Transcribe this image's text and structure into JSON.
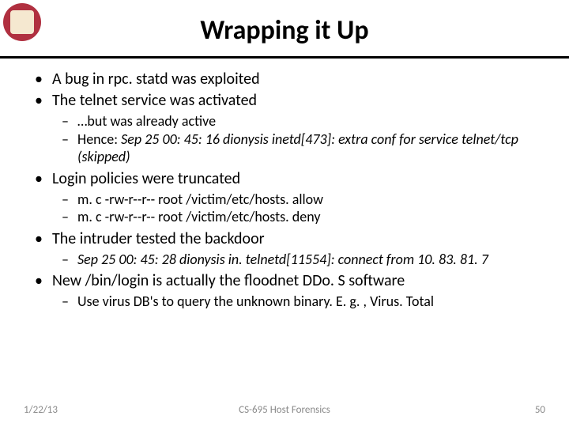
{
  "title": "Wrapping it Up",
  "bullets": {
    "b1": "A bug in rpc. statd was exploited",
    "b2": "The telnet service was activated",
    "b2_sub": {
      "s1": "…but was already active",
      "s2_prefix": "Hence: ",
      "s2_italic": "Sep 25 00: 45: 16 dionysis inetd[473]: extra conf for service telnet/tcp (skipped)"
    },
    "b3": "Login policies were truncated",
    "b3_sub": {
      "s1": "m. c -rw-r--r-- root /victim/etc/hosts. allow",
      "s2": "m. c -rw-r--r-- root /victim/etc/hosts. deny"
    },
    "b4": "The intruder tested the backdoor",
    "b4_sub": {
      "s1": "Sep 25 00: 45: 28 dionysis in. telnetd[11554]: connect from 10. 83. 81. 7"
    },
    "b5": "New /bin/login is actually the floodnet DDo. S software",
    "b5_sub": {
      "s1": "Use virus DB's to query the unknown binary. E. g. , Virus. Total"
    }
  },
  "footer": {
    "date": "1/22/13",
    "course": "CS-695 Host Forensics",
    "page": "50"
  }
}
